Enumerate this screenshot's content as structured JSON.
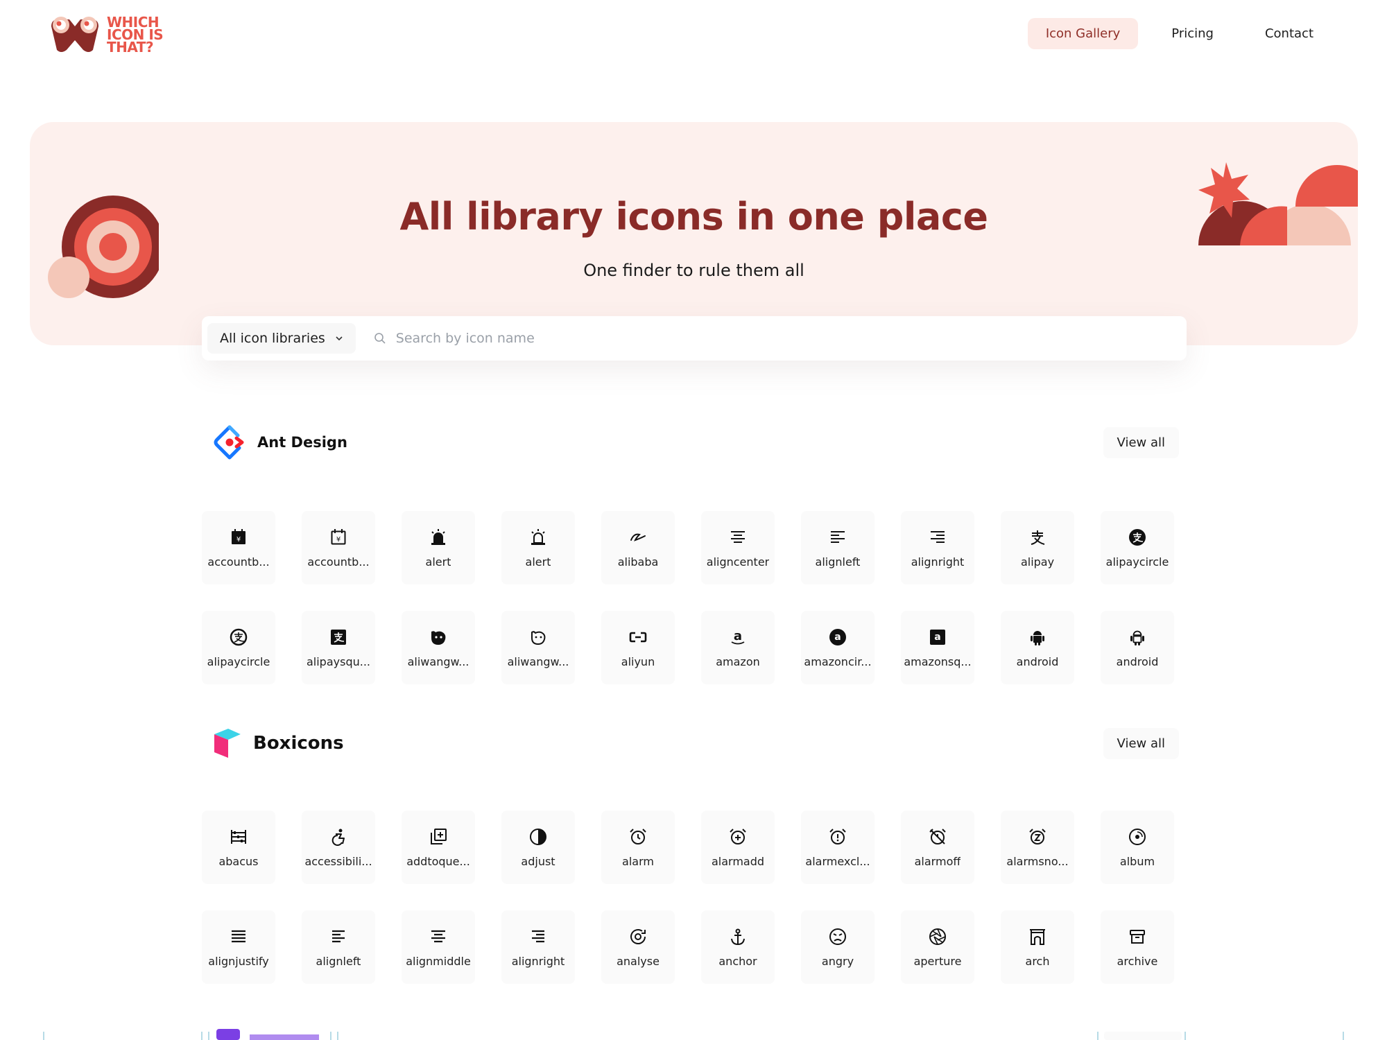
{
  "header": {
    "logo_lines": [
      "WHICH",
      "ICON IS",
      "THAT?"
    ],
    "nav": [
      {
        "label": "Icon Gallery",
        "active": true
      },
      {
        "label": "Pricing",
        "active": false
      },
      {
        "label": "Contact",
        "active": false
      }
    ]
  },
  "hero": {
    "title_regular": "All library icons ",
    "title_bold": "in one place",
    "subtitle": "One finder to rule them all"
  },
  "search": {
    "library_select": "All icon libraries",
    "placeholder": "Search by icon name"
  },
  "sections": [
    {
      "name": "Ant Design",
      "view_all": "View all",
      "icons": [
        {
          "label": "accountb...",
          "icon": "account-book-filled-icon"
        },
        {
          "label": "accountb...",
          "icon": "account-book-outlined-icon"
        },
        {
          "label": "alert",
          "icon": "alert-filled-icon"
        },
        {
          "label": "alert",
          "icon": "alert-outlined-icon"
        },
        {
          "label": "alibaba",
          "icon": "alibaba-icon"
        },
        {
          "label": "aligncenter",
          "icon": "align-center-icon"
        },
        {
          "label": "alignleft",
          "icon": "align-left-icon"
        },
        {
          "label": "alignright",
          "icon": "align-right-icon"
        },
        {
          "label": "alipay",
          "icon": "alipay-icon"
        },
        {
          "label": "alipaycircle",
          "icon": "alipay-circle-filled-icon"
        },
        {
          "label": "alipaycircle",
          "icon": "alipay-circle-outlined-icon"
        },
        {
          "label": "alipaysqu...",
          "icon": "alipay-square-icon"
        },
        {
          "label": "aliwangw...",
          "icon": "aliwangwang-filled-icon"
        },
        {
          "label": "aliwangw...",
          "icon": "aliwangwang-outlined-icon"
        },
        {
          "label": "aliyun",
          "icon": "aliyun-icon"
        },
        {
          "label": "amazon",
          "icon": "amazon-icon"
        },
        {
          "label": "amazoncir...",
          "icon": "amazon-circle-icon"
        },
        {
          "label": "amazonsq...",
          "icon": "amazon-square-icon"
        },
        {
          "label": "android",
          "icon": "android-filled-icon"
        },
        {
          "label": "android",
          "icon": "android-outlined-icon"
        }
      ]
    },
    {
      "name": "Boxicons",
      "view_all": "View all",
      "icons": [
        {
          "label": "abacus",
          "icon": "abacus-icon"
        },
        {
          "label": "accessibili...",
          "icon": "accessibility-icon"
        },
        {
          "label": "addtoque...",
          "icon": "add-to-queue-icon"
        },
        {
          "label": "adjust",
          "icon": "adjust-icon"
        },
        {
          "label": "alarm",
          "icon": "alarm-icon"
        },
        {
          "label": "alarmadd",
          "icon": "alarm-add-icon"
        },
        {
          "label": "alarmexcl...",
          "icon": "alarm-exclamation-icon"
        },
        {
          "label": "alarmoff",
          "icon": "alarm-off-icon"
        },
        {
          "label": "alarmsno...",
          "icon": "alarm-snooze-icon"
        },
        {
          "label": "album",
          "icon": "album-icon"
        },
        {
          "label": "alignjustify",
          "icon": "align-justify-icon"
        },
        {
          "label": "alignleft",
          "icon": "align-left-icon"
        },
        {
          "label": "alignmiddle",
          "icon": "align-middle-icon"
        },
        {
          "label": "alignright",
          "icon": "align-right-icon"
        },
        {
          "label": "analyse",
          "icon": "analyse-icon"
        },
        {
          "label": "anchor",
          "icon": "anchor-icon"
        },
        {
          "label": "angry",
          "icon": "angry-icon"
        },
        {
          "label": "aperture",
          "icon": "aperture-icon"
        },
        {
          "label": "arch",
          "icon": "arch-icon"
        },
        {
          "label": "archive",
          "icon": "archive-icon"
        }
      ]
    }
  ],
  "colors": {
    "brand": "#e8564a",
    "hero_bg": "#fdf0ed",
    "hero_title": "#8a2b28",
    "nav_active_bg": "#fdeae6"
  }
}
